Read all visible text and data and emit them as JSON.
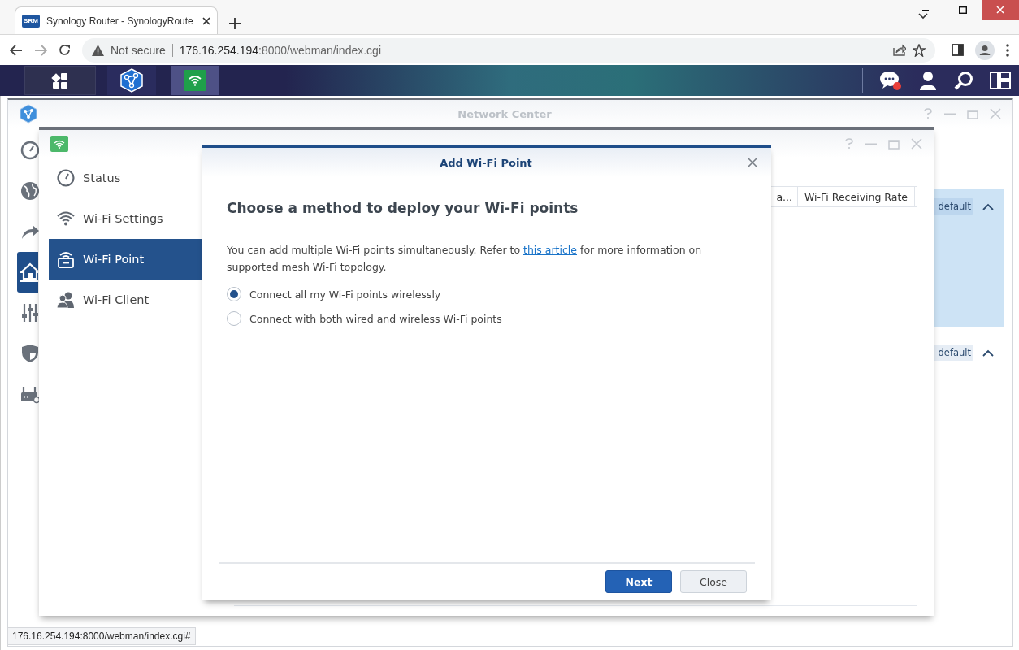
{
  "browser": {
    "tab": {
      "favicon": "SRM",
      "title": "Synology Router - SynologyRoute"
    },
    "not_secure": "Not secure",
    "url_host": "176.16.254.194",
    "url_rest": ":8000/webman/index.cgi"
  },
  "taskbar": {
    "apps": [
      {
        "kind": "menu",
        "selected": false
      },
      {
        "kind": "network",
        "selected": false
      },
      {
        "kind": "wifi",
        "selected": true
      }
    ],
    "notification_dot": true
  },
  "network_center": {
    "title": "Network Center",
    "nav": [
      {
        "kind": "gauge",
        "selected": false
      },
      {
        "kind": "globe",
        "selected": false
      },
      {
        "kind": "arrow",
        "selected": false
      },
      {
        "kind": "home",
        "selected": true
      },
      {
        "kind": "sliders",
        "selected": false
      },
      {
        "kind": "shield",
        "selected": false
      },
      {
        "kind": "router",
        "selected": false
      }
    ],
    "rows": [
      {
        "badge": "default",
        "expanded": true,
        "selected": true
      },
      {
        "badge": "default",
        "expanded": true,
        "selected": false
      }
    ]
  },
  "wifi_connect": {
    "sidebar": [
      {
        "kind": "status",
        "label": "Status",
        "selected": false
      },
      {
        "kind": "wifi",
        "label": "Wi-Fi Settings",
        "selected": false
      },
      {
        "kind": "point",
        "label": "Wi-Fi Point",
        "selected": true
      },
      {
        "kind": "client",
        "label": "Wi-Fi Client",
        "selected": false
      }
    ],
    "columns": [
      "a...",
      "Wi-Fi Receiving Rate"
    ]
  },
  "dialog": {
    "title": "Add Wi-Fi Point",
    "heading": "Choose a method to deploy your Wi-Fi points",
    "text_before": "You can add multiple Wi-Fi points simultaneously. Refer to ",
    "link": "this article",
    "text_after": " for more information on supported mesh Wi-Fi topology.",
    "options": [
      {
        "label": "Connect all my Wi-Fi points wirelessly",
        "selected": true
      },
      {
        "label": "Connect with both wired and wireless Wi-Fi points",
        "selected": false
      }
    ],
    "buttons": [
      {
        "label": "Next",
        "kind": "primary"
      },
      {
        "label": "Close",
        "kind": "secondary"
      }
    ]
  },
  "status_url": "176.16.254.194:8000/webman/index.cgi#"
}
